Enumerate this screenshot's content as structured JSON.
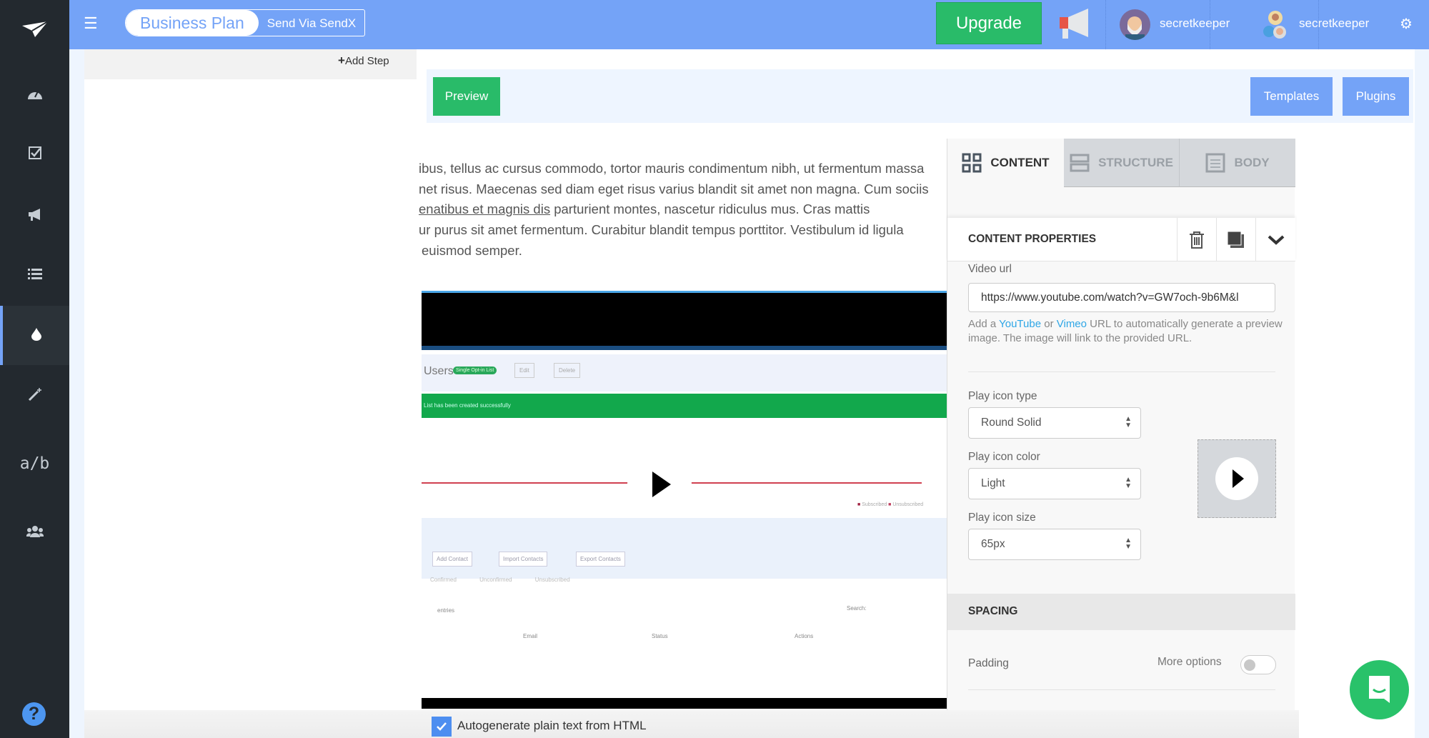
{
  "topbar": {
    "menu_icon": "hamburger-icon",
    "plan_label": "Business Plan",
    "send_via": "Send Via SendX",
    "upgrade": "Upgrade",
    "users": [
      {
        "name": "secretkeeper"
      },
      {
        "name": "secretkeeper"
      }
    ]
  },
  "sidebar": {
    "items": [
      {
        "icon": "dashboard-icon"
      },
      {
        "icon": "checklist-icon"
      },
      {
        "icon": "megaphone-icon"
      },
      {
        "icon": "list-icon"
      },
      {
        "icon": "drip-icon",
        "active": true
      },
      {
        "icon": "magic-wand-icon"
      },
      {
        "label": "a/b"
      },
      {
        "icon": "users-icon"
      }
    ],
    "help": "?"
  },
  "left_panel": {
    "add_step": "Add Step"
  },
  "toolbar": {
    "preview": "Preview",
    "templates": "Templates",
    "plugins": "Plugins"
  },
  "content": {
    "lines": [
      "ibus, tellus ac cursus commodo, tortor mauris condimentum nibh, ut fermentum massa",
      "net risus. Maecenas sed diam eget risus varius blandit sit amet non magna. Cum sociis",
      "parturient montes, nascetur ridiculus mus. Cras mattis",
      "ur purus sit amet fermentum. Curabitur blandit tempus porttitor. Vestibulum id ligula",
      "euismod semper."
    ],
    "link_text": "enatibus et magnis dis"
  },
  "video_preview": {
    "title": "Users",
    "badge": "Single Opt-in List",
    "edit": "Edit",
    "delete": "Delete",
    "alert": "List has been created successfully",
    "add_contact": "Add Contact",
    "import_contacts": "Import Contacts",
    "export_contacts": "Export Contacts",
    "filters": [
      "Confirmed",
      "Unconfirmed",
      "Unsubscribed"
    ],
    "entries": "entries",
    "search": "Search:",
    "columns": [
      "Email",
      "Status",
      "Actions"
    ],
    "legend": [
      "Subscribed",
      "Unsubscribed"
    ]
  },
  "panel": {
    "tabs": [
      {
        "label": "CONTENT",
        "active": true
      },
      {
        "label": "STRUCTURE"
      },
      {
        "label": "BODY"
      }
    ],
    "properties_title": "CONTENT PROPERTIES",
    "video_url_label": "Video url",
    "video_url": "https://www.youtube.com/watch?v=GW7och-9b6M&l",
    "help_pre": "Add a ",
    "youtube": "YouTube",
    "help_or": " or ",
    "vimeo": "Vimeo",
    "help_post": " URL to automatically generate a preview image. The image will link to the provided URL.",
    "play_type_label": "Play icon type",
    "play_type": "Round Solid",
    "play_color_label": "Play icon color",
    "play_color": "Light",
    "play_size_label": "Play icon size",
    "play_size": "65px",
    "spacing": "SPACING",
    "padding": "Padding",
    "more_options": "More options",
    "more_options_on": false
  },
  "footer": {
    "autogen": "Autogenerate plain text from HTML",
    "autogen_checked": true
  },
  "colors": {
    "topbar": "#74a3f7",
    "sidebar": "#23292f",
    "green": "#29bb69",
    "link": "#2ea6e6"
  }
}
